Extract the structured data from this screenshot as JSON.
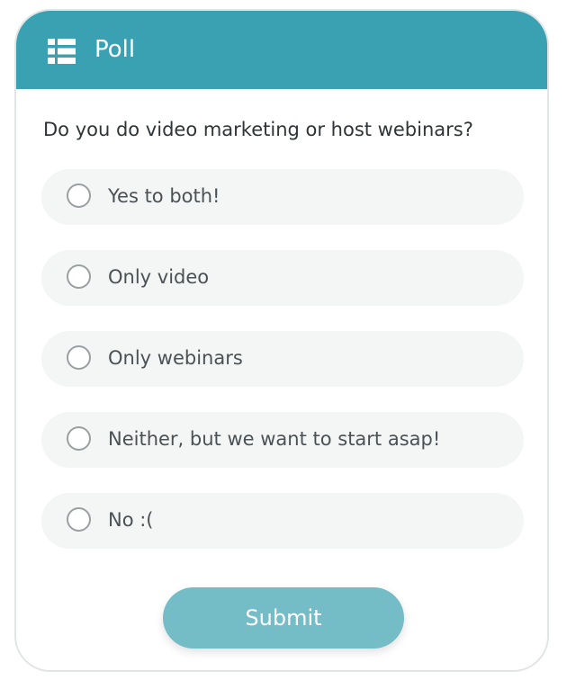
{
  "header": {
    "icon": "list-icon",
    "title": "Poll"
  },
  "question": "Do you do video marketing or host webinars?",
  "options": [
    {
      "label": "Yes to both!",
      "selected": false
    },
    {
      "label": "Only video",
      "selected": false
    },
    {
      "label": "Only webinars",
      "selected": false
    },
    {
      "label": "Neither, but we want to start asap!",
      "selected": false
    },
    {
      "label": "No :(",
      "selected": false
    }
  ],
  "submit_label": "Submit",
  "colors": {
    "header_bg": "#3aa1b2",
    "option_bg": "#f4f5f5",
    "submit_bg": "#74bdc7",
    "text": "#2f3437"
  }
}
